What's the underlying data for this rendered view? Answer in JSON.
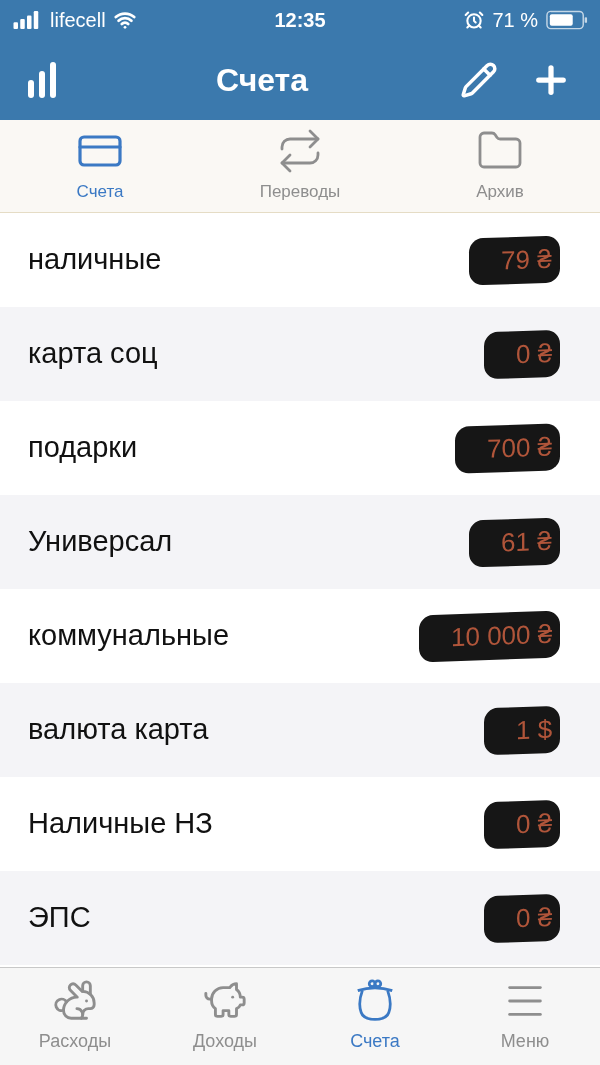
{
  "status_bar": {
    "carrier": "lifecell",
    "time": "12:35",
    "battery": "71 %"
  },
  "nav": {
    "title": "Счета"
  },
  "segments": [
    {
      "label": "Счета",
      "selected": true
    },
    {
      "label": "Переводы",
      "selected": false
    },
    {
      "label": "Архив",
      "selected": false
    }
  ],
  "accounts": [
    {
      "name": "наличные",
      "amount": "79 ₴"
    },
    {
      "name": "карта соц",
      "amount": "0 ₴"
    },
    {
      "name": "подарки",
      "amount": "700 ₴"
    },
    {
      "name": "Универсал",
      "amount": "61 ₴"
    },
    {
      "name": "коммунальные",
      "amount": "10 000 ₴"
    },
    {
      "name": "валюта карта",
      "amount": "1 $"
    },
    {
      "name": "Наличные НЗ",
      "amount": "0 ₴"
    },
    {
      "name": "ЭПС",
      "amount": "0 ₴"
    }
  ],
  "tab_bar": [
    {
      "label": "Расходы",
      "selected": false
    },
    {
      "label": "Доходы",
      "selected": false
    },
    {
      "label": "Счета",
      "selected": true
    },
    {
      "label": "Меню",
      "selected": false
    }
  ]
}
